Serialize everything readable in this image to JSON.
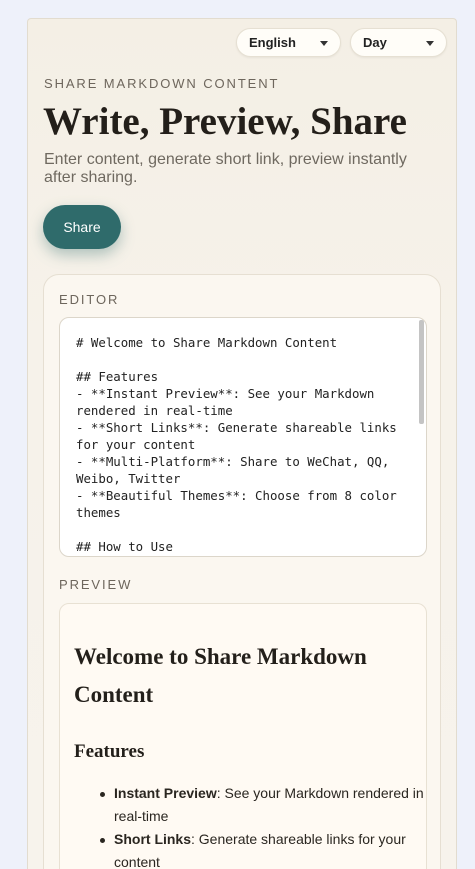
{
  "header": {
    "language_select": "English",
    "theme_select": "Day"
  },
  "hero": {
    "eyebrow": "SHARE MARKDOWN CONTENT",
    "title": "Write, Preview, Share",
    "subtitle": "Enter content, generate short link, preview instantly after sharing.",
    "share_label": "Share"
  },
  "editor": {
    "label": "EDITOR",
    "content": "# Welcome to Share Markdown Content\n\n## Features\n- **Instant Preview**: See your Markdown rendered in real-time\n- **Short Links**: Generate shareable links for your content\n- **Multi-Platform**: Share to WeChat, QQ, Weibo, Twitter\n- **Beautiful Themes**: Choose from 8 color themes\n\n## How to Use"
  },
  "preview": {
    "label": "PREVIEW",
    "h1": "Welcome to Share Markdown Content",
    "h2": "Features",
    "items": [
      {
        "bold": "Instant Preview",
        "text": ": See your Markdown rendered in real-time"
      },
      {
        "bold": "Short Links",
        "text": ": Generate shareable links for your content"
      }
    ]
  }
}
